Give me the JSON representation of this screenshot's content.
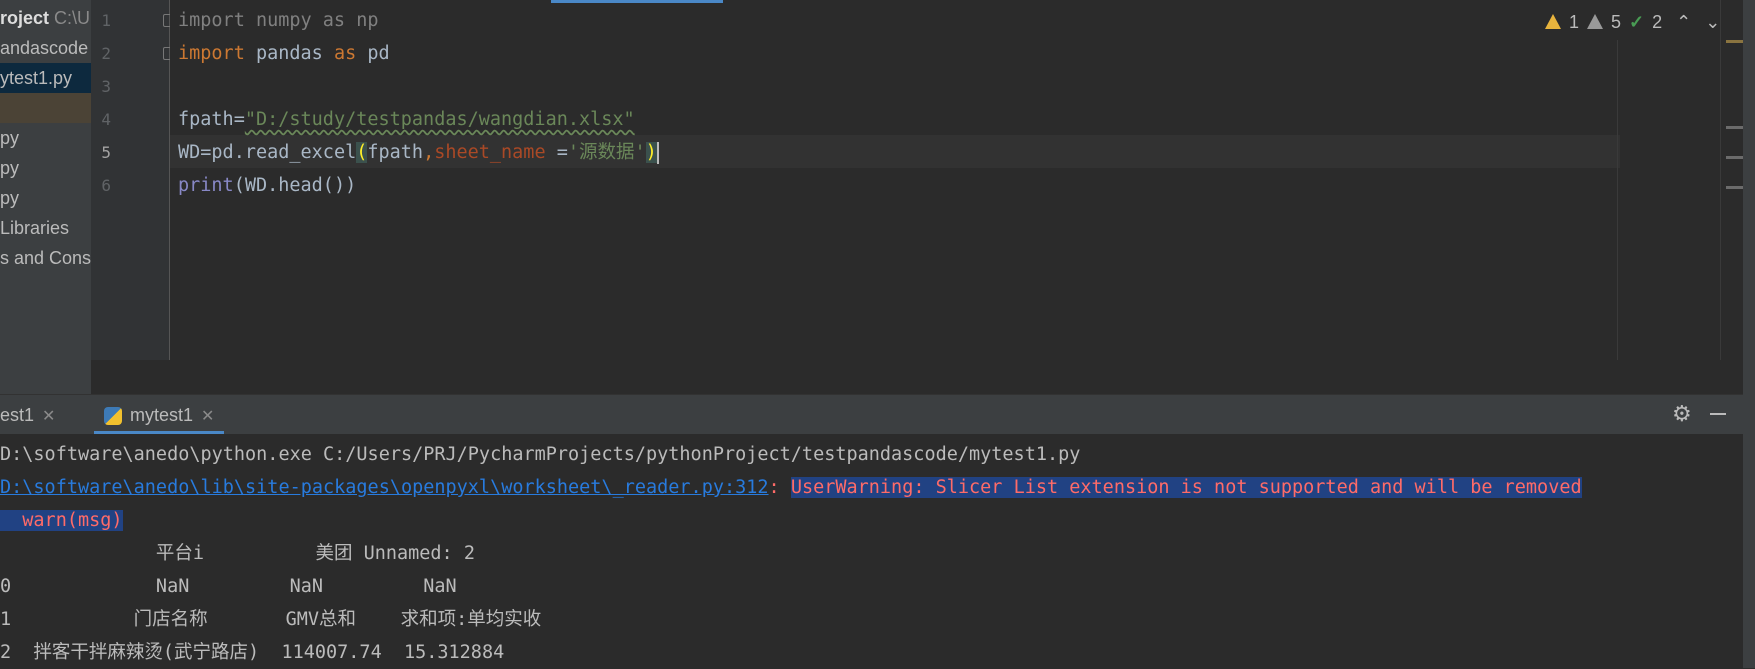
{
  "sidebar": {
    "items": [
      {
        "label": "roject",
        "path": "C:\\U"
      },
      {
        "label": "andascode"
      },
      {
        "label": "ytest1.py"
      },
      {
        "label": ""
      },
      {
        "label": "py"
      },
      {
        "label": "py"
      },
      {
        "label": "py"
      },
      {
        "label": "Libraries"
      },
      {
        "label": "s and Conso"
      }
    ]
  },
  "editor": {
    "line_numbers": [
      "1",
      "2",
      "3",
      "4",
      "5",
      "6"
    ],
    "lines": {
      "l1": {
        "kw1": "import",
        "mod": " numpy ",
        "kw2": "as",
        "alias": " np"
      },
      "l2": {
        "kw1": "import",
        "mod": " pandas ",
        "kw2": "as",
        "alias": " pd"
      },
      "l4": {
        "name": "fpath",
        "eq": "=",
        "str": "\"D:/study/testpandas/wangdian.xlsx\""
      },
      "l5": {
        "name": "WD",
        "eq": "=",
        "call": "pd.read_excel",
        "open": "(",
        "arg": "fpath",
        "comma": ",",
        "param": "sheet_name",
        "peq": " =",
        "str": "'源数据'",
        "close": ")"
      },
      "l6": {
        "fn": "print",
        "rest": "(WD.head())"
      }
    },
    "inspections": {
      "errors": "1",
      "warnings": "5",
      "weak": "2"
    }
  },
  "run_panel": {
    "tabs": [
      {
        "label": "est1"
      },
      {
        "label": "mytest1"
      }
    ],
    "console": {
      "cmd": "D:\\software\\anedo\\python.exe C:/Users/PRJ/PycharmProjects/pythonProject/testpandascode/mytest1.py",
      "warn_link": "D:\\software\\anedo\\lib\\site-packages\\openpyxl\\worksheet\\_reader.py:312",
      "warn_sep": ": ",
      "warn_msg": "UserWarning: Slicer List extension is not supported and will be removed",
      "warn_call": "  warn(msg)",
      "out_header": "              平台i          美团 Unnamed: 2",
      "out_row0": "0             NaN         NaN         NaN",
      "out_row1": "1           门店名称       GMV总和    求和项:单均实收",
      "out_row2": "2  拌客干拌麻辣烫(武宁路店)  114007.74  15.312884"
    }
  }
}
